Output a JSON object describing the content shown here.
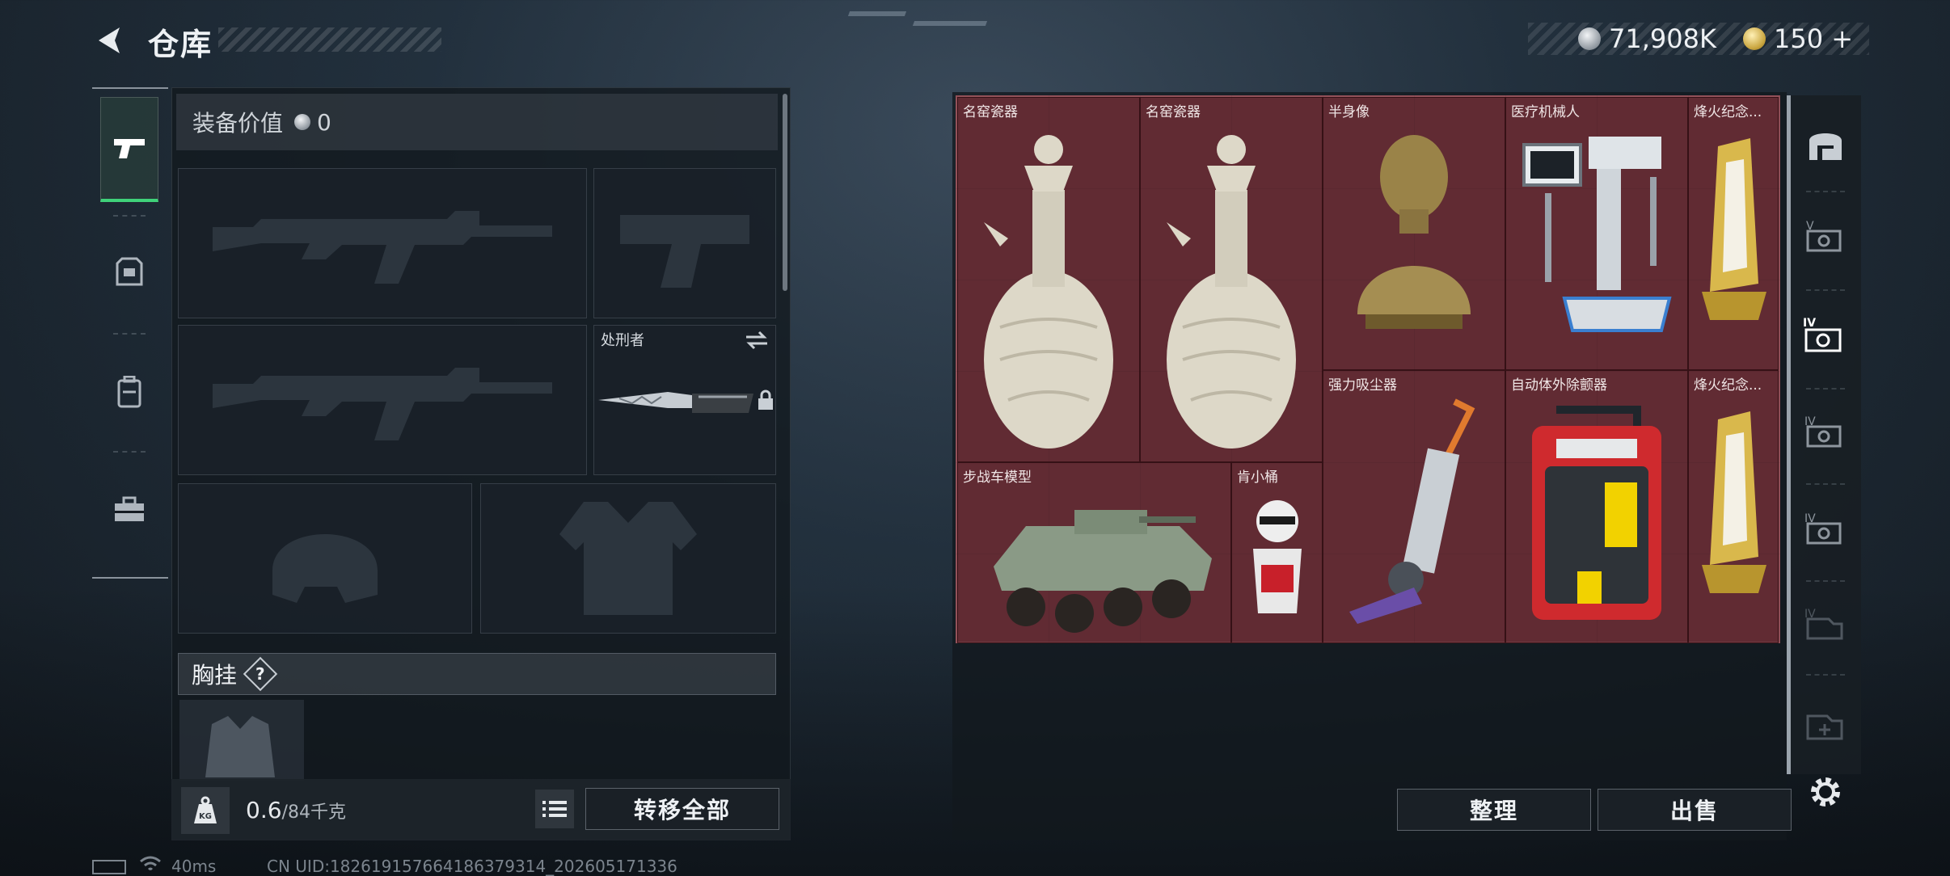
{
  "header": {
    "title": "仓库",
    "currency_main": "71,908K",
    "currency_premium": "150 +"
  },
  "equipment": {
    "value_label": "装备价值",
    "value_amount": "0",
    "melee_label": "处刑者",
    "chest_label": "胸挂",
    "help_glyph": "?",
    "weight_current": "0.6",
    "weight_capacity": "/84千克",
    "kg_badge": "KG",
    "transfer_all": "转移全部"
  },
  "stash": {
    "items": [
      {
        "label": "名窑瓷器"
      },
      {
        "label": "名窑瓷器"
      },
      {
        "label": "半身像"
      },
      {
        "label": "医疗机械人"
      },
      {
        "label": "烽火纪念..."
      },
      {
        "label": "强力吸尘器"
      },
      {
        "label": "自动体外除颤器"
      },
      {
        "label": "烽火纪念..."
      },
      {
        "label": "步战车模型"
      },
      {
        "label": "肯小桶"
      }
    ],
    "tidy_button": "整理",
    "sell_button": "出售"
  },
  "status_bar": {
    "ping": "40ms",
    "uid": "CN UID:182619157664186379314_202605171336"
  },
  "colors": {
    "accent_green": "#3fd27a",
    "stash_bg": "#5e2a31"
  },
  "icons": {
    "nav": [
      "pistol-icon",
      "armor-icon",
      "backpack-icon",
      "toolbox-icon"
    ],
    "side_tabs": [
      "stash-home-icon",
      "stash-tab-5-icon",
      "stash-tab-4-icon",
      "stash-tab-3-icon",
      "stash-tab-2-icon",
      "stash-tab-1-icon",
      "add-stash-icon",
      "settings-icon"
    ]
  }
}
